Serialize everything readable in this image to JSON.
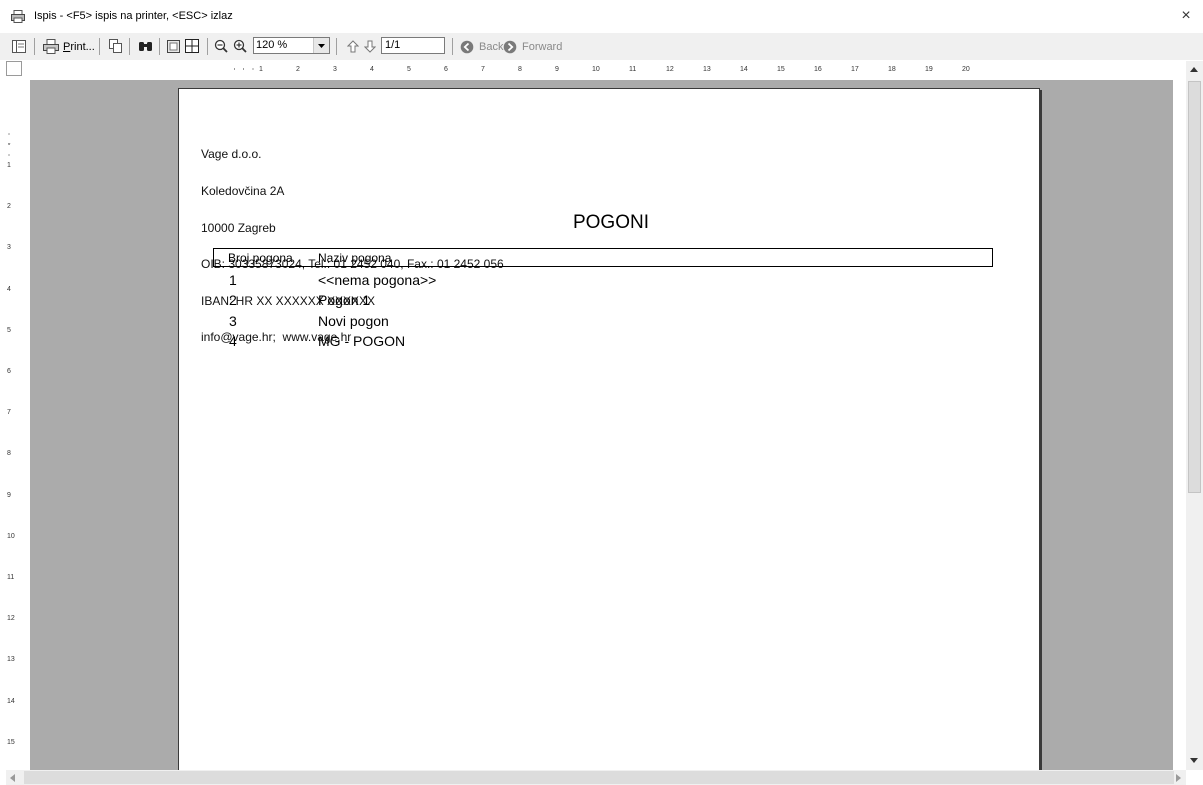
{
  "window": {
    "title": "Ispis - <F5> ispis na printer, <ESC> izlaz",
    "close_glyph": "×"
  },
  "toolbar": {
    "print_label": "Print...",
    "zoom_value": "120 %",
    "page_value": "1/1",
    "back_label": "Back",
    "forward_label": "Forward",
    "icons": [
      "panel-toggle-icon",
      "printer-icon",
      "copy-icon",
      "find-icon",
      "single-page-icon",
      "multi-page-icon",
      "zoom-out-icon",
      "zoom-in-icon",
      "prev-page-icon",
      "next-page-icon",
      "back-icon",
      "forward-icon"
    ]
  },
  "rulers": {
    "horizontal": [
      "1",
      "2",
      "3",
      "4",
      "5",
      "6",
      "7",
      "8",
      "9",
      "10",
      "11",
      "12",
      "13",
      "14",
      "15",
      "16",
      "17",
      "18",
      "19",
      "20"
    ],
    "vertical": [
      "1",
      "2",
      "3",
      "4",
      "5",
      "6",
      "7",
      "8",
      "9",
      "10",
      "11",
      "12",
      "13",
      "14",
      "15"
    ]
  },
  "report": {
    "company_lines": [
      "Vage d.o.o.",
      "Koledovčina 2A",
      "10000 Zagreb",
      "OIB: 30335873024, Tel.: 01 2452 040, Fax.: 01 2452 056",
      "IBAN: HR XX XXXXXX XXXXXX",
      "info@vage.hr;  www.vage.hr"
    ],
    "title": "POGONI",
    "columns": [
      "Broj pogona",
      "Naziv pogona"
    ],
    "rows": [
      {
        "num": "1",
        "name": "<<nema pogona>>"
      },
      {
        "num": "2",
        "name": "Pogon 1"
      },
      {
        "num": "3",
        "name": "Novi pogon"
      },
      {
        "num": "4",
        "name": "MG - POGON"
      }
    ]
  },
  "colors": {
    "preview_background": "#ababab",
    "toolbar_background": "#f0f0f0",
    "page": "#ffffff"
  }
}
